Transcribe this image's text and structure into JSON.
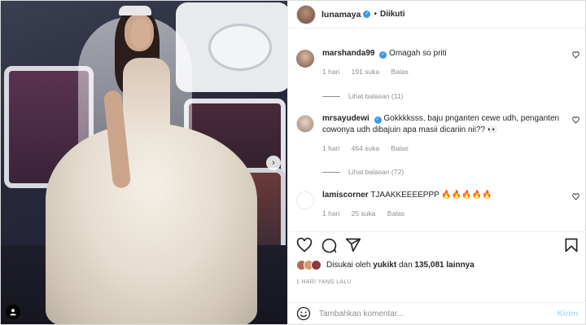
{
  "post": {
    "author": "lunamaya",
    "follow_state": "Diikuti",
    "separator": "•"
  },
  "comments": [
    {
      "user": "marshanda99",
      "verified": true,
      "text": "Omagah so priti",
      "time": "1 hari",
      "likes": "191 suka",
      "reply": "Balas",
      "replies_label": "Lihat balasan (11)"
    },
    {
      "user": "mrsayudewi",
      "verified": true,
      "text": "Gokkkksss, baju pnganten cewe udh, penganten cowonya udh dibajuin apa masii dicariin nii?? 👀",
      "time": "1 hari",
      "likes": "464 suka",
      "reply": "Balas",
      "replies_label": "Lihat balasan (72)"
    },
    {
      "user": "lamiscorner",
      "verified": false,
      "text": "TJAAKKEEEEPPP 🔥🔥🔥🔥🔥",
      "time": "1 hari",
      "likes": "25 suka",
      "reply": "Balas"
    }
  ],
  "likes": {
    "prefix": "Disukai oleh",
    "first_user": "yukikt",
    "connector": "dan",
    "count": "135,081 lainnya"
  },
  "timestamp": "1 HARI YANG LALU",
  "composer": {
    "placeholder": "Tambahkan komentar...",
    "send_label": "Kirim"
  },
  "colors": {
    "verified": "#3897f0",
    "muted": "#8e8e8e",
    "send_disabled": "#b2dffc"
  },
  "icons": [
    "heart-icon",
    "comment-icon",
    "share-icon",
    "bookmark-icon",
    "emoji-icon",
    "chevron-right-icon",
    "user-tag-icon",
    "verified-icon"
  ]
}
